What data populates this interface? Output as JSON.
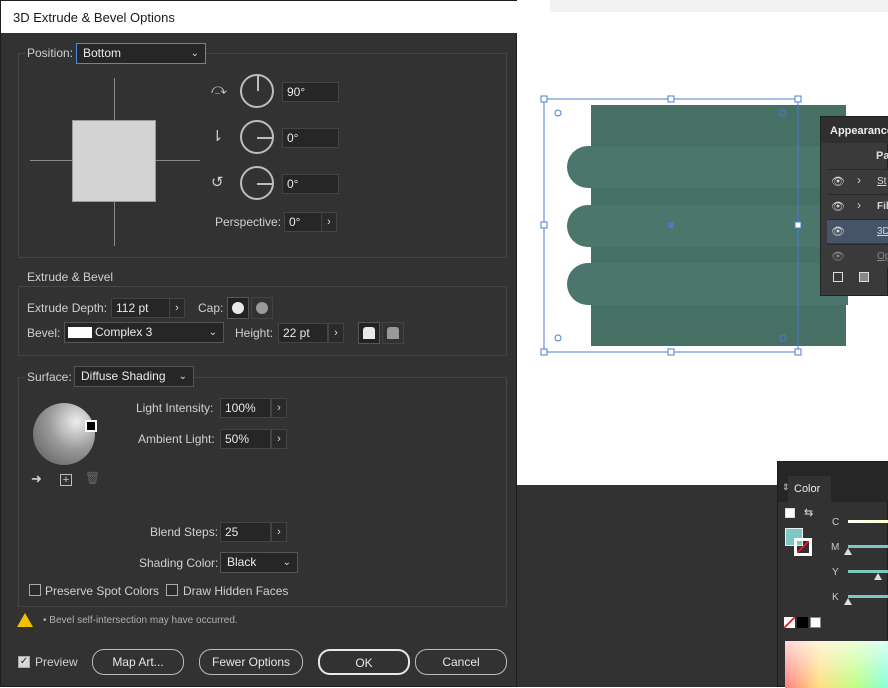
{
  "dialog": {
    "title": "3D Extrude & Bevel Options",
    "position": {
      "label": "Position:",
      "value": "Bottom",
      "rot_x": "90°",
      "rot_y": "0°",
      "rot_z": "0°",
      "perspective_label": "Perspective:",
      "perspective_value": "0°"
    },
    "extrude": {
      "section_title": "Extrude & Bevel",
      "depth_label": "Extrude Depth:",
      "depth_value": "112 pt",
      "cap_label": "Cap:",
      "bevel_label": "Bevel:",
      "bevel_value": "Complex 3",
      "height_label": "Height:",
      "height_value": "22 pt"
    },
    "surface": {
      "label": "Surface:",
      "value": "Diffuse Shading",
      "light_intensity_label": "Light Intensity:",
      "light_intensity_value": "100%",
      "ambient_light_label": "Ambient Light:",
      "ambient_light_value": "50%",
      "blend_steps_label": "Blend Steps:",
      "blend_steps_value": "25",
      "shading_color_label": "Shading Color:",
      "shading_color_value": "Black",
      "preserve_spot_label": "Preserve Spot Colors",
      "draw_hidden_label": "Draw Hidden Faces"
    },
    "warning": "• Bevel self-intersection may have occurred.",
    "footer": {
      "preview_label": "Preview",
      "map_art_label": "Map Art...",
      "fewer_options_label": "Fewer Options",
      "ok_label": "OK",
      "cancel_label": "Cancel"
    }
  },
  "appearance_panel": {
    "title": "Appearance",
    "rows": [
      "Pa",
      "St",
      "Fil",
      "3D",
      "Op"
    ]
  },
  "color_panel": {
    "title": "Color",
    "channels": [
      "C",
      "M",
      "Y",
      "K"
    ]
  },
  "colors": {
    "object_fill": "#477065",
    "selection": "#4a7bd8",
    "swatch": "#7ec8c4"
  }
}
